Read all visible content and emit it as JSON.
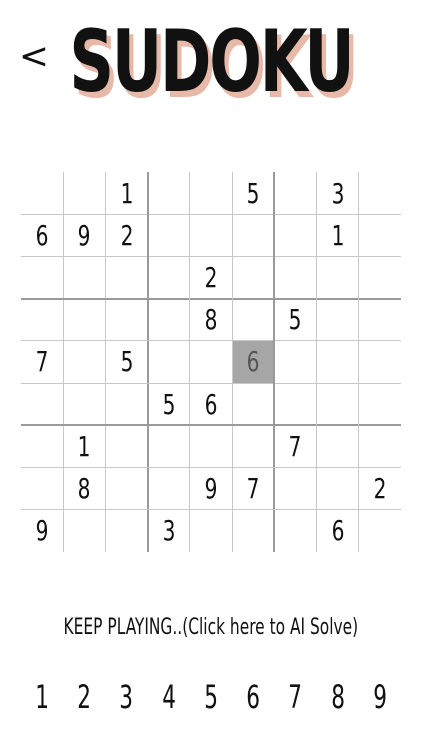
{
  "header": {
    "back_label": "<",
    "title": "SUDOKU"
  },
  "board": {
    "rows": [
      [
        "",
        "",
        "1",
        "",
        "",
        "5",
        "",
        "3",
        ""
      ],
      [
        "6",
        "9",
        "2",
        "",
        "",
        "",
        "",
        "1",
        ""
      ],
      [
        "",
        "",
        "",
        "",
        "2",
        "",
        "",
        "",
        ""
      ],
      [
        "",
        "",
        "",
        "",
        "8",
        "",
        "5",
        "",
        ""
      ],
      [
        "7",
        "",
        "5",
        "",
        "",
        "6",
        "",
        "",
        ""
      ],
      [
        "",
        "",
        "",
        "5",
        "6",
        "",
        "",
        "",
        ""
      ],
      [
        "",
        "1",
        "",
        "",
        "",
        "",
        "7",
        "",
        ""
      ],
      [
        "",
        "8",
        "",
        "",
        "9",
        "7",
        "",
        "",
        "2"
      ],
      [
        "9",
        "",
        "",
        "3",
        "",
        "",
        "",
        "6",
        ""
      ]
    ],
    "selected_cell": {
      "row": 4,
      "col": 5
    },
    "selected_color": "#a6a6a6"
  },
  "status": {
    "ai_solve_label": "KEEP PLAYING..(Click here to AI Solve)"
  },
  "numpad": {
    "numbers": [
      "1",
      "2",
      "3",
      "4",
      "5",
      "6",
      "7",
      "8",
      "9"
    ]
  },
  "colors": {
    "title_shadow": "#e6b9a8",
    "grid_thin": "#c8c8c8",
    "grid_thick": "#9a9a9a"
  }
}
